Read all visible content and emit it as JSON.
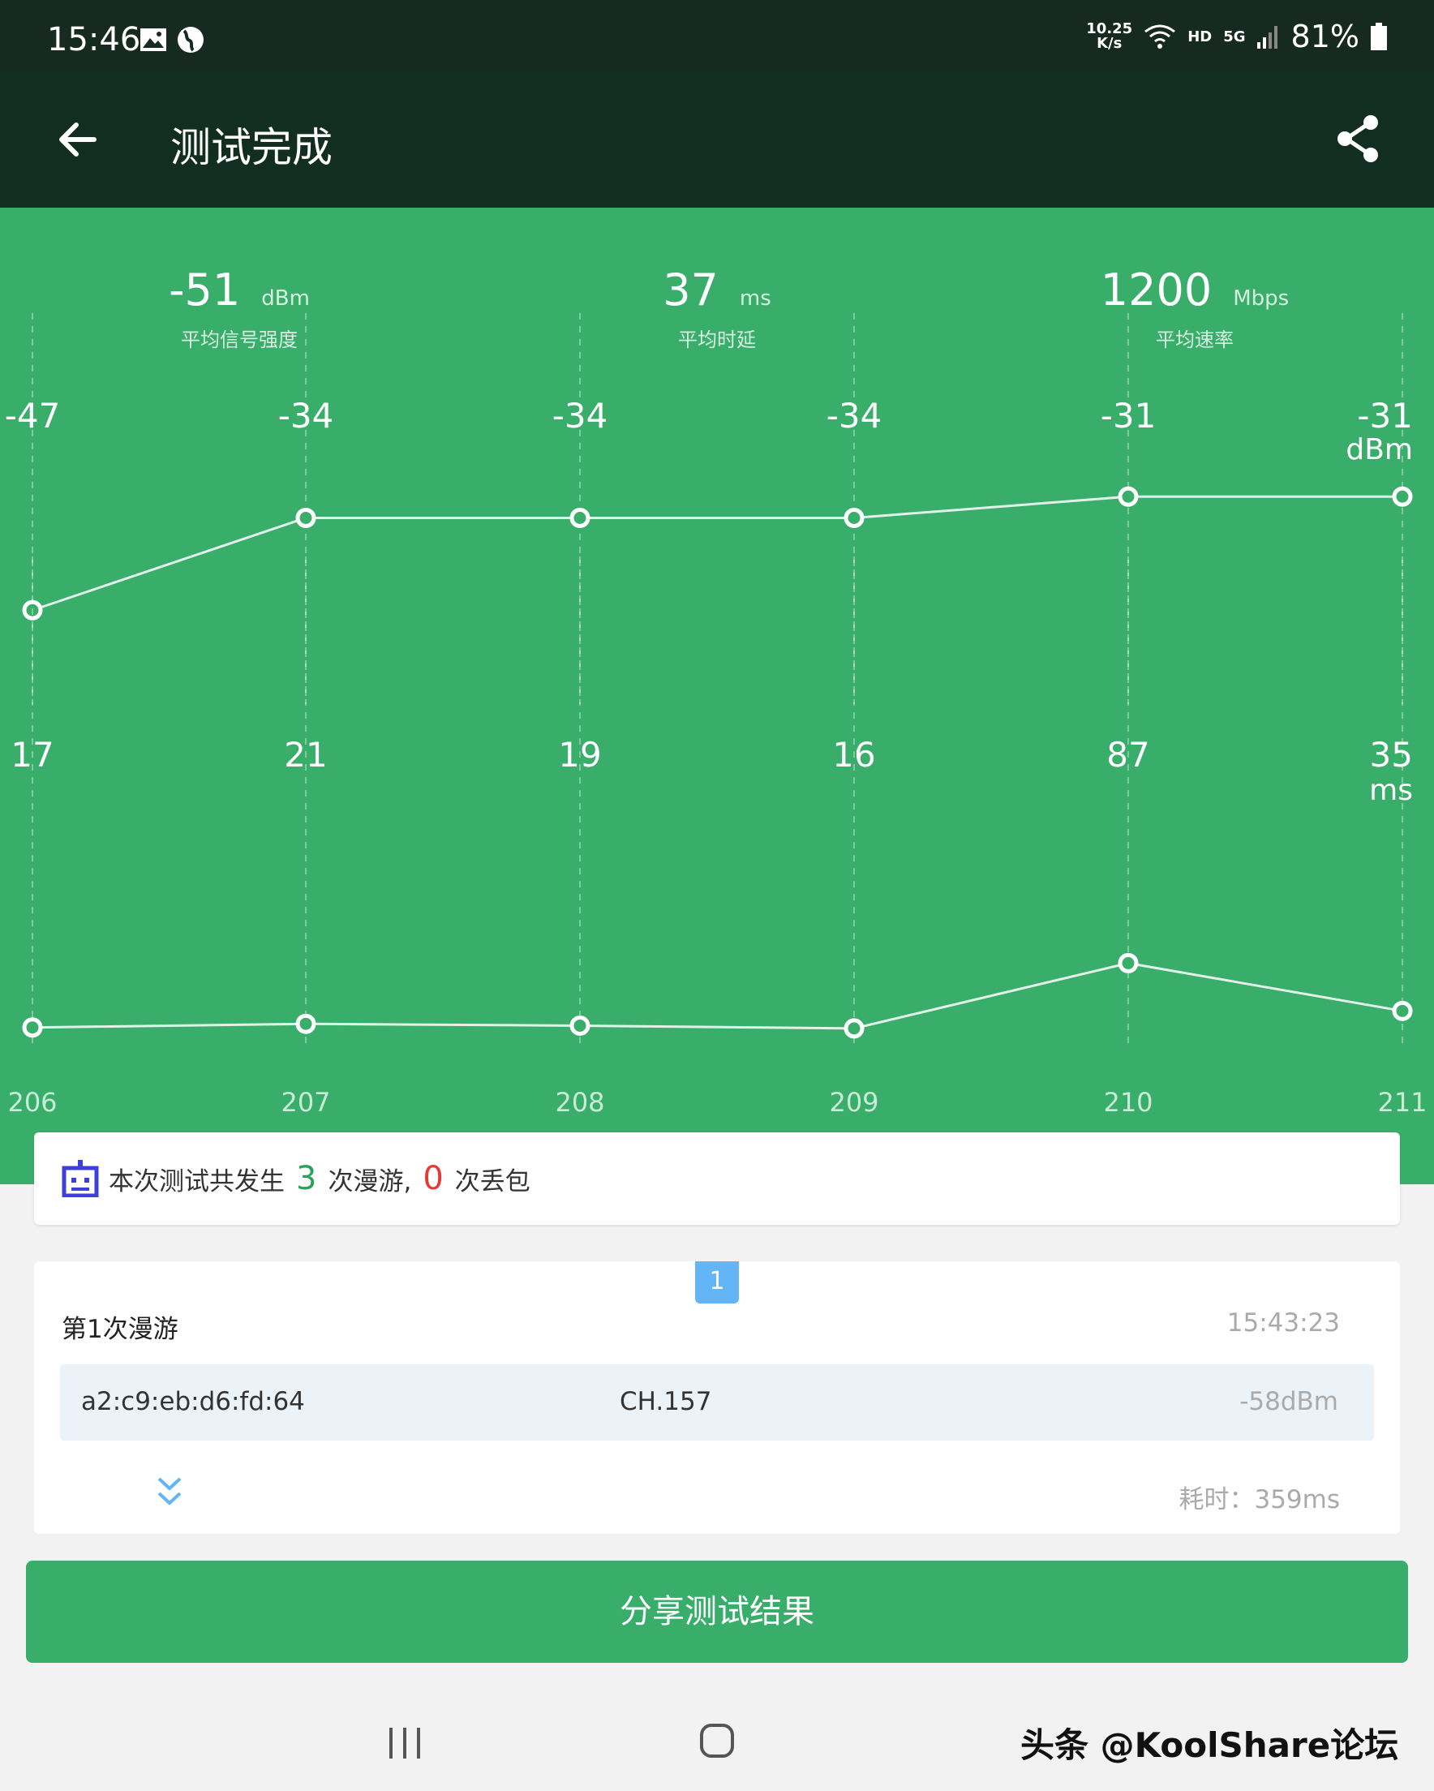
{
  "status_bar": {
    "time": "15:46",
    "net_speed_value": "10.25",
    "net_speed_unit": "K/s",
    "hd": "HD",
    "network": "5G",
    "battery": "81%"
  },
  "app_bar": {
    "title": "测试完成"
  },
  "stats": [
    {
      "value": "-51",
      "unit": "dBm",
      "label": "平均信号强度"
    },
    {
      "value": "37",
      "unit": "ms",
      "label": "平均时延"
    },
    {
      "value": "1200",
      "unit": "Mbps",
      "label": "平均速率"
    }
  ],
  "chart_data": [
    {
      "type": "line",
      "x": [
        "206",
        "207",
        "208",
        "209",
        "210",
        "211"
      ],
      "series": [
        {
          "values": [
            -47,
            -34,
            -34,
            -34,
            -31,
            -31
          ]
        }
      ],
      "unit": "dBm"
    },
    {
      "type": "line",
      "x": [
        "206",
        "207",
        "208",
        "209",
        "210",
        "211"
      ],
      "series": [
        {
          "values": [
            17,
            21,
            19,
            16,
            87,
            35
          ]
        }
      ],
      "unit": "ms"
    }
  ],
  "summary": {
    "prefix": "本次测试共发生",
    "roams": "3",
    "middle": "次漫游,",
    "drops": "0",
    "suffix": "次丢包"
  },
  "roam": {
    "badge": "1",
    "title": "第1次漫游",
    "time": "15:43:23",
    "mac": "a2:c9:eb:d6:fd:64",
    "channel": "CH.157",
    "signal": "-58dBm",
    "duration": "耗时：359ms"
  },
  "share_button": "分享测试结果",
  "watermark": "头条 @KoolShare论坛",
  "colors": {
    "green": "#39ad6a",
    "dark_header": "#122e22",
    "accent_blue": "#64b5f6",
    "red": "#e53935"
  }
}
